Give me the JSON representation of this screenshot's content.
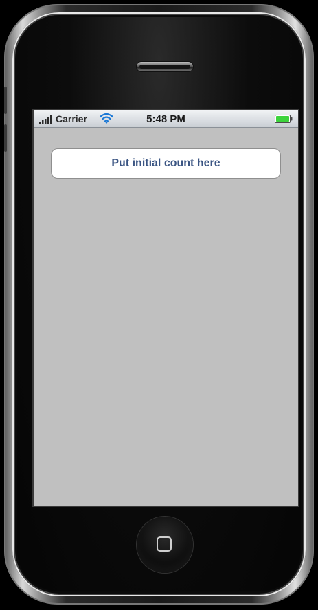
{
  "status_bar": {
    "carrier": "Carrier",
    "time": "5:48 PM",
    "signal_icon": "signal-bars-icon",
    "wifi_icon": "wifi-icon",
    "battery_icon": "battery-icon"
  },
  "main": {
    "count_button_label": "Put initial count here"
  },
  "device": {
    "home_icon": "home-square-icon",
    "speaker": "earpiece-speaker"
  },
  "colors": {
    "content_background": "#c0c0c0",
    "button_text": "#3b5583",
    "battery_fill": "#3cd33c"
  }
}
